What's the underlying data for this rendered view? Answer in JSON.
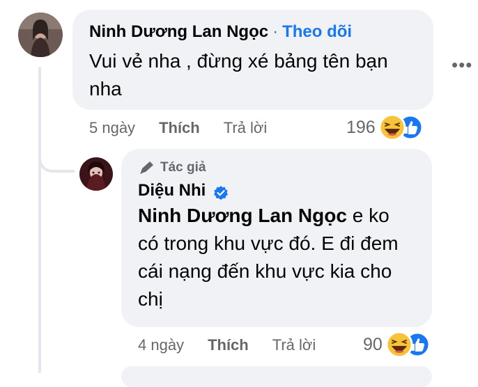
{
  "comment1": {
    "author": "Ninh Dương Lan Ngọc",
    "separator": "·",
    "follow_label": "Theo dõi",
    "text": "Vui vẻ nha , đừng xé bảng tên bạn nha",
    "time": "5 ngày",
    "like_label": "Thích",
    "reply_label": "Trả lời",
    "reaction_count": "196",
    "reactions": [
      "haha-icon",
      "like-icon"
    ]
  },
  "reply1": {
    "badge_label": "Tác giả",
    "author": "Diệu Nhi",
    "verified": true,
    "mention": "Ninh Dương Lan Ngọc",
    "text": " e ko có trong khu vực đó. E đi đem cái nạng đến khu vực kia cho chị",
    "time": "4 ngày",
    "like_label": "Thích",
    "reply_label": "Trả lời",
    "reaction_count": "90",
    "reactions": [
      "haha-icon",
      "like-icon"
    ]
  },
  "more_icon": "more-dots-icon",
  "colors": {
    "bubble": "#f0f2f5",
    "link": "#1877f2",
    "muted": "#65676b",
    "thread_line": "#e4e6eb"
  }
}
